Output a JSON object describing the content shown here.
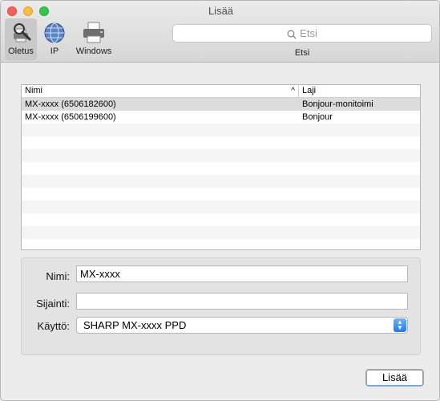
{
  "window": {
    "title": "Lisää"
  },
  "toolbar": {
    "buttons": [
      {
        "label": "Oletus",
        "icon": "default-printer-icon",
        "selected": true
      },
      {
        "label": "IP",
        "icon": "globe-icon",
        "selected": false
      },
      {
        "label": "Windows",
        "icon": "printer-icon",
        "selected": false
      }
    ],
    "search": {
      "placeholder": "Etsi",
      "caption": "Etsi"
    }
  },
  "table": {
    "columns": [
      "Nimi",
      "Laji"
    ],
    "sort_indicator": "^",
    "rows": [
      {
        "name": "MX-xxxx (6506182600)",
        "kind": "Bonjour-monitoimi"
      },
      {
        "name": "MX-xxxx (6506199600)",
        "kind": "Bonjour"
      }
    ]
  },
  "form": {
    "name_label": "Nimi:",
    "name_value": "MX-xxxx",
    "location_label": "Sijainti:",
    "location_value": "",
    "use_label": "Käyttö:",
    "use_value": "SHARP MX-xxxx PPD"
  },
  "footer": {
    "add_label": "Lisää"
  }
}
